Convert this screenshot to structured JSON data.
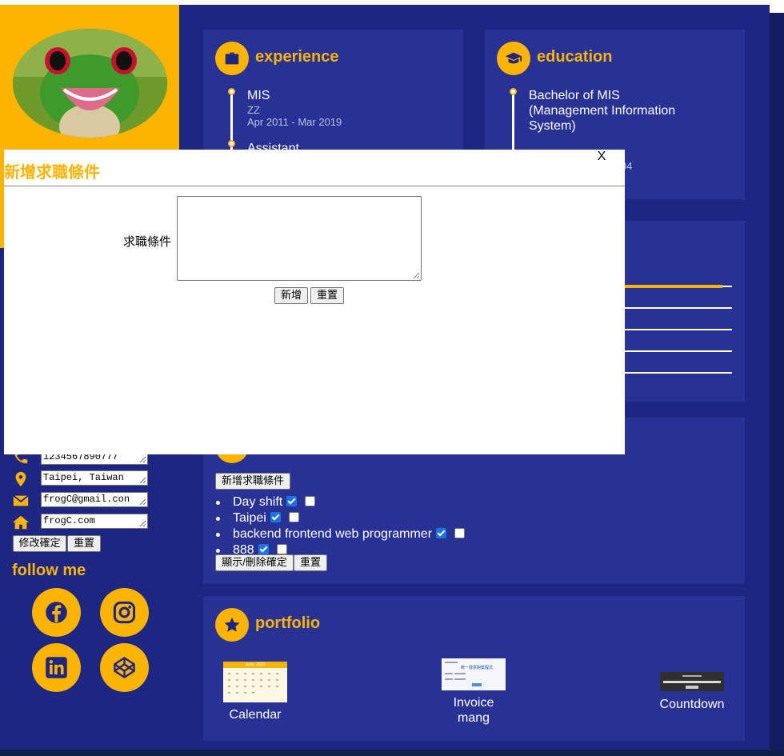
{
  "profile": {
    "avatar_alt": "frog avatar"
  },
  "experience": {
    "title": "experience",
    "items": [
      {
        "title": "MIS",
        "company": "ZZ",
        "date": "Apr 2011 - Mar 2019"
      },
      {
        "title": "Assistant"
      }
    ]
  },
  "education": {
    "title": "education",
    "items": [
      {
        "title": "Bachelor of MIS\n(Management Information\nSystem)",
        "date_partial": "04"
      }
    ]
  },
  "skills": {
    "levels": [
      0.91,
      0,
      0,
      0,
      0
    ]
  },
  "contact": {
    "phone": "1234567890777",
    "location": "Taipei, Taiwan",
    "email": "frogC@gmail.con",
    "website": "frogC.com",
    "confirm_label": "修改確定",
    "reset_label": "重置"
  },
  "follow": {
    "title": "follow me"
  },
  "job_prefs": {
    "add_label": "新增求職條件",
    "items": [
      {
        "label": "Day shift",
        "display": true,
        "delete": false
      },
      {
        "label": "Taipei",
        "display": true,
        "delete": false
      },
      {
        "label": "backend frontend web programmer",
        "display": true,
        "delete": false
      },
      {
        "label": "888",
        "display": true,
        "delete": false
      }
    ],
    "confirm_label": "顯示/刪除確定",
    "reset_label": "重置"
  },
  "portfolio": {
    "title": "portfolio",
    "items": [
      {
        "label": "Calendar",
        "thumb_heading": "June, 2020"
      },
      {
        "label": "Invoice\nmang",
        "thumb_heading": "統一發票對獎程式"
      },
      {
        "label": "Countdown",
        "thumb_heading": ""
      }
    ]
  },
  "modal": {
    "title": "新增求職條件",
    "close": "X",
    "field_label": "求職條件",
    "textarea_value": "",
    "add_label": "新增",
    "reset_label": "重置"
  },
  "colors": {
    "accent": "#fdb400",
    "navy": "#1d2683",
    "card": "#273294",
    "checkbox": "#1a73e8"
  }
}
